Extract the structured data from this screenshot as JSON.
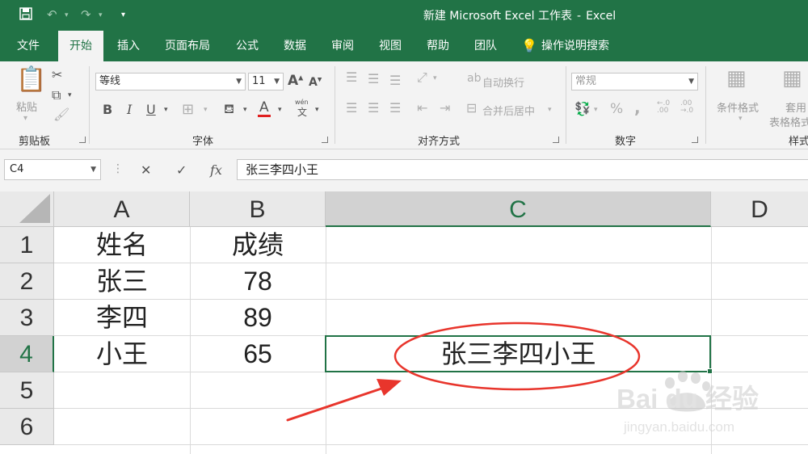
{
  "window": {
    "title": "新建 Microsoft Excel 工作表",
    "app_name": "Excel"
  },
  "tabs": [
    {
      "label": "文件"
    },
    {
      "label": "开始"
    },
    {
      "label": "插入"
    },
    {
      "label": "页面布局"
    },
    {
      "label": "公式"
    },
    {
      "label": "数据"
    },
    {
      "label": "审阅"
    },
    {
      "label": "视图"
    },
    {
      "label": "帮助"
    },
    {
      "label": "团队"
    }
  ],
  "active_tab": "开始",
  "tell_me": {
    "label": "操作说明搜索",
    "icon": "lightbulb-icon"
  },
  "ribbon": {
    "clipboard": {
      "paste_label": "粘贴",
      "group_label": "剪贴板"
    },
    "font": {
      "name": "等线",
      "size": "11",
      "group_label": "字体",
      "bold": "B",
      "italic": "I",
      "underline": "U",
      "font_color_glyph": "A",
      "font_color": "#e02020",
      "wen_top": "wén",
      "wen_bottom": "文"
    },
    "alignment": {
      "wrap_label": "自动换行",
      "merge_label": "合并后居中",
      "group_label": "对齐方式"
    },
    "number": {
      "format": "常规",
      "group_label": "数字",
      "percent": "%",
      "comma": ","
    },
    "styles": {
      "conditional_label": "条件格式",
      "table_label_1": "套用",
      "table_label_2": "表格格式",
      "group_label": "样式"
    }
  },
  "formula_bar": {
    "name_box": "C4",
    "fx_label": "fx",
    "formula": "张三李四小王"
  },
  "grid": {
    "columns": [
      "A",
      "B",
      "C",
      "D"
    ],
    "selected_column": "C",
    "rows": [
      "1",
      "2",
      "3",
      "4",
      "5",
      "6"
    ],
    "selected_row": "4",
    "cells": [
      {
        "A": "姓名",
        "B": "成绩",
        "C": ""
      },
      {
        "A": "张三",
        "B": "78",
        "C": ""
      },
      {
        "A": "李四",
        "B": "89",
        "C": ""
      },
      {
        "A": "小王",
        "B": "65",
        "C": "张三李四小王"
      }
    ],
    "active_cell": "C4"
  },
  "annotation": {
    "color": "#e8352c"
  },
  "watermark": {
    "brand": "Bai du 经验",
    "url": "jingyan.baidu.com"
  },
  "colors": {
    "accent": "#217346",
    "ribbon_bg": "#f3f3f3",
    "header_bg": "#e9e9e9"
  }
}
